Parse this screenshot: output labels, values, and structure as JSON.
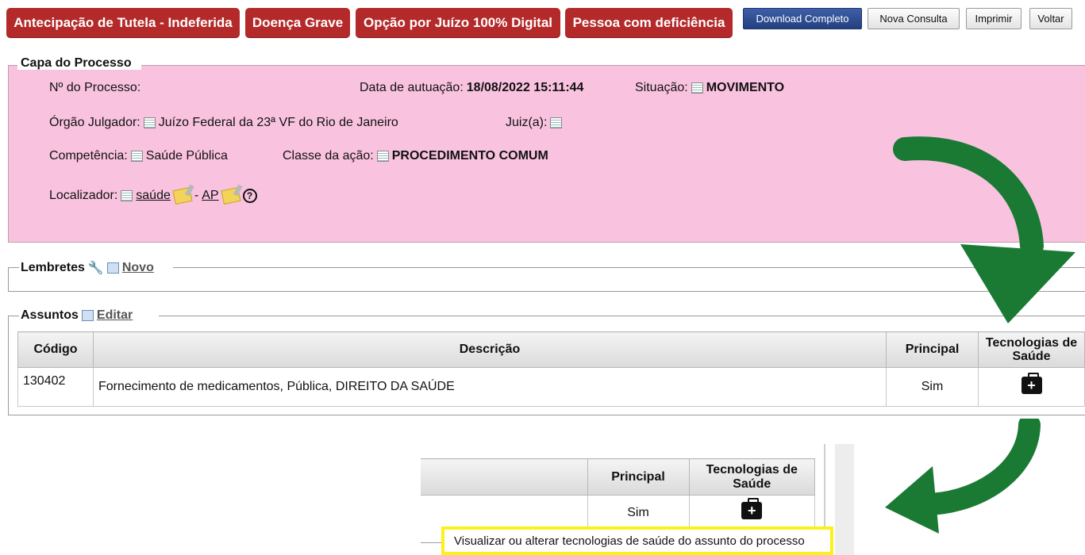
{
  "badges": [
    "Antecipação de Tutela - Indeferida",
    "Doença Grave",
    "Opção por Juízo 100% Digital",
    "Pessoa com deficiência"
  ],
  "toolbar": {
    "download": "Download Completo",
    "nova_consulta": "Nova Consulta",
    "imprimir": "Imprimir",
    "voltar": "Voltar"
  },
  "capa": {
    "legend": "Capa do Processo",
    "numero_label": "Nº do Processo:",
    "data_label": "Data de autuação:",
    "data_value": "18/08/2022 15:11:44",
    "situacao_label": "Situação:",
    "situacao_value": "MOVIMENTO",
    "orgao_label": "Órgão Julgador:",
    "orgao_value": "Juízo Federal da 23ª VF do Rio de Janeiro",
    "juiz_label": "Juiz(a):",
    "competencia_label": "Competência:",
    "competencia_value": "Saúde Pública",
    "classe_label": "Classe da ação:",
    "classe_value": "PROCEDIMENTO COMUM",
    "localizador_label": "Localizador:",
    "localizador_1": "saúde",
    "localizador_sep": " - ",
    "localizador_2": "AP"
  },
  "lembretes": {
    "legend": "Lembretes",
    "novo": "Novo"
  },
  "assuntos": {
    "legend": "Assuntos",
    "editar": "Editar",
    "headers": [
      "Código",
      "Descrição",
      "Principal",
      "Tecnologias de Saúde"
    ],
    "row": {
      "codigo": "130402",
      "descricao": "Fornecimento de medicamentos, Pública, DIREITO DA SAÚDE",
      "principal": "Sim"
    }
  },
  "zoom": {
    "headers": [
      "Principal",
      "Tecnologias de Saúde"
    ],
    "principal": "Sim",
    "tooltip": "Visualizar ou alterar tecnologias de saúde do assunto do processo"
  },
  "colors": {
    "badge": "#b42a2a",
    "capa_bg": "#f9c3e0",
    "arrow": "#1a7a34",
    "highlight": "#ffef1a"
  }
}
